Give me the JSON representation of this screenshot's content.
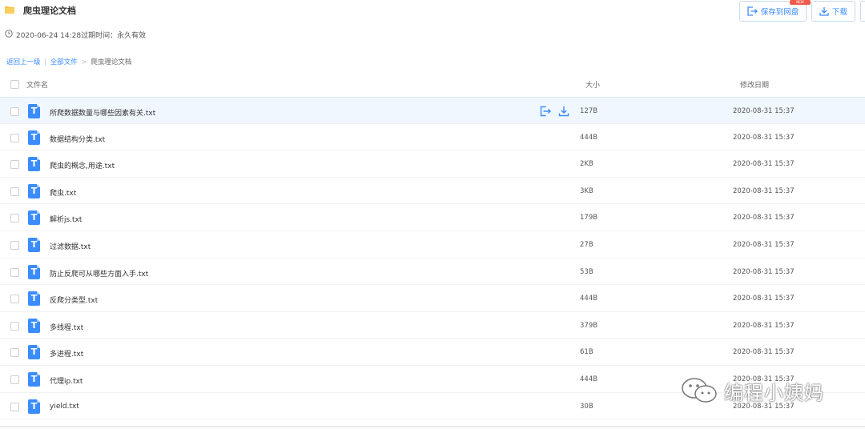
{
  "folder": {
    "title": "爬虫理论文档",
    "meta": "2020-06-24 14:28过期时间：永久有效"
  },
  "toolbar": {
    "save_label": "保存到网盘",
    "download_label": "下载",
    "badge_text": "NEW"
  },
  "breadcrumb": {
    "back": "返回上一级",
    "sep1": "|",
    "all": "全部文件",
    "sep2": ">",
    "current": "爬虫理论文档"
  },
  "columns": {
    "name": "文件名",
    "size": "大小",
    "date": "修改日期"
  },
  "files": [
    {
      "name": "所爬数据数量与哪些因素有关.txt",
      "size": "127B",
      "date": "2020-08-31 15:37"
    },
    {
      "name": "数据结构分类.txt",
      "size": "444B",
      "date": "2020-08-31 15:37"
    },
    {
      "name": "爬虫的概念,用途.txt",
      "size": "2KB",
      "date": "2020-08-31 15:37"
    },
    {
      "name": "爬虫.txt",
      "size": "3KB",
      "date": "2020-08-31 15:37"
    },
    {
      "name": "解析js.txt",
      "size": "179B",
      "date": "2020-08-31 15:37"
    },
    {
      "name": "过滤数据.txt",
      "size": "27B",
      "date": "2020-08-31 15:37"
    },
    {
      "name": "防止反爬可从哪些方面入手.txt",
      "size": "53B",
      "date": "2020-08-31 15:37"
    },
    {
      "name": "反爬分类型.txt",
      "size": "444B",
      "date": "2020-08-31 15:37"
    },
    {
      "name": "多线程.txt",
      "size": "379B",
      "date": "2020-08-31 15:37"
    },
    {
      "name": "多进程.txt",
      "size": "61B",
      "date": "2020-08-31 15:37"
    },
    {
      "name": "代理ip.txt",
      "size": "444B",
      "date": "2020-08-31 15:37"
    },
    {
      "name": "yield.txt",
      "size": "30B",
      "date": "2020-08-31 15:37"
    }
  ],
  "file_icon_letter": "T",
  "watermark": "编程小姨妈",
  "colors": {
    "accent": "#3b8cff",
    "folder": "#f5c342",
    "badge": "#ee5b4a",
    "hover_row": "#f0f7ff"
  }
}
